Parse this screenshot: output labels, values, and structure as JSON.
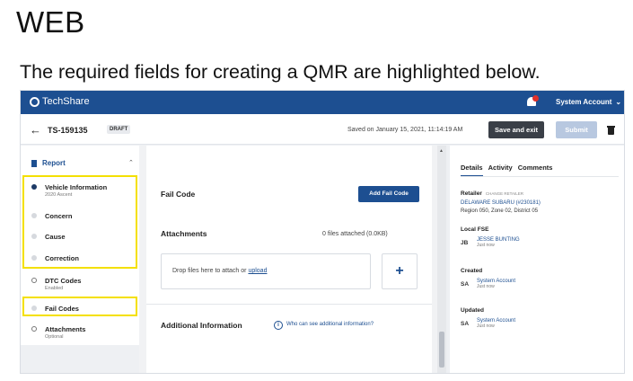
{
  "slide": {
    "heading": "WEB",
    "subheading": "The required fields for creating a QMR are highlighted below."
  },
  "topbar": {
    "brand": "TechShare",
    "account_label": "System Account",
    "account_chevron": "⌄",
    "bell_icon": "bell-icon",
    "brand_color": "#1d4f91"
  },
  "subbar": {
    "back_arrow": "←",
    "record_id": "TS-159135",
    "status_badge": "DRAFT",
    "saved_text": "Saved on January 15, 2021, 11:14:19 AM",
    "save_exit_label": "Save and exit",
    "submit_label": "Submit"
  },
  "sidebar": {
    "report_label": "Report",
    "report_chevron": "⌃",
    "items": [
      {
        "label": "Vehicle Information",
        "sub": "2020 Ascent"
      },
      {
        "label": "Concern",
        "sub": ""
      },
      {
        "label": "Cause",
        "sub": ""
      },
      {
        "label": "Correction",
        "sub": ""
      },
      {
        "label": "DTC Codes",
        "sub": "Enabled"
      },
      {
        "label": "Fail Codes",
        "sub": ""
      },
      {
        "label": "Attachments",
        "sub": "Optional"
      }
    ],
    "highlight_color": "#f4e000"
  },
  "main": {
    "fail_code_title": "Fail Code",
    "add_fail_code_label": "Add Fail Code",
    "attachments_title": "Attachments",
    "files_count": "0 files attached (0.0KB)",
    "drop_text": "Drop files here to attach or ",
    "upload_link": "upload",
    "plus": "+",
    "additional_title": "Additional Information",
    "info_glyph": "i",
    "info_link": "Who can see additional information?"
  },
  "right_panel": {
    "tabs": [
      "Details",
      "Activity",
      "Comments"
    ],
    "retailer_label": "Retailer",
    "change_retailer": "CHANGE RETAILER",
    "retailer_name": "DELAWARE SUBARU (#230181)",
    "retailer_region": "Region 050, Zone 02, District 05",
    "local_fse_label": "Local FSE",
    "fse": {
      "initials": "JB",
      "name": "JESSE BUNTING",
      "when": "Just now"
    },
    "created_label": "Created",
    "created": {
      "initials": "SA",
      "name": "System Account",
      "when": "Just now"
    },
    "updated_label": "Updated",
    "updated": {
      "initials": "SA",
      "name": "System Account",
      "when": "Just now"
    }
  }
}
